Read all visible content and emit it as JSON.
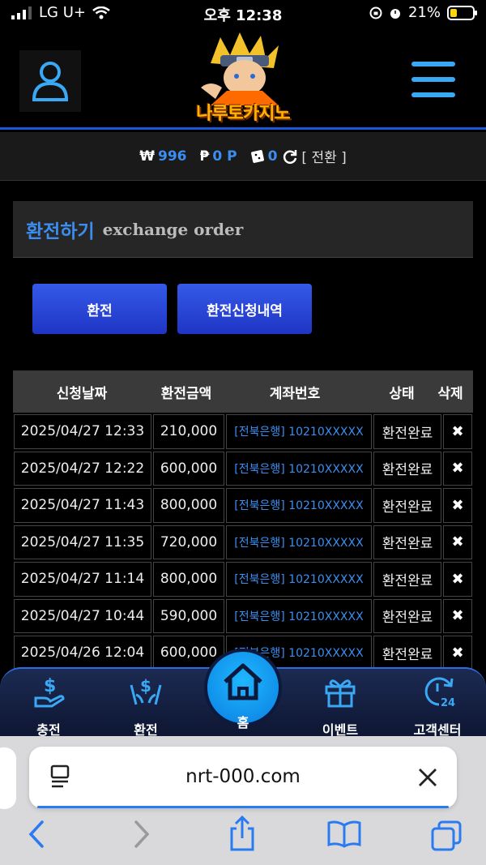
{
  "status_bar": {
    "carrier": "LG U+",
    "time": "오후 12:38",
    "battery": "21%"
  },
  "header": {
    "logo_text": "나루토카지노"
  },
  "balance": {
    "won_symbol": "₩",
    "won_value": "996",
    "point_symbol": "₱",
    "point_value": "0 P",
    "chip_value": "0",
    "convert_label": "[ 전환 ]"
  },
  "section": {
    "title_ko": "환전하기",
    "title_en": "exchange order"
  },
  "buttons": {
    "exchange": "환전",
    "history": "환전신청내역"
  },
  "table": {
    "headers": [
      "신청날짜",
      "환전금액",
      "계좌번호",
      "상태",
      "삭제"
    ],
    "rows": [
      {
        "date": "2025/04/27 12:33",
        "amount": "210,000",
        "account": "[전북은행] 10210XXXXX",
        "status": "환전완료"
      },
      {
        "date": "2025/04/27 12:22",
        "amount": "600,000",
        "account": "[전북은행] 10210XXXXX",
        "status": "환전완료"
      },
      {
        "date": "2025/04/27 11:43",
        "amount": "800,000",
        "account": "[전북은행] 10210XXXXX",
        "status": "환전완료"
      },
      {
        "date": "2025/04/27 11:35",
        "amount": "720,000",
        "account": "[전북은행] 10210XXXXX",
        "status": "환전완료"
      },
      {
        "date": "2025/04/27 11:14",
        "amount": "800,000",
        "account": "[전북은행] 10210XXXXX",
        "status": "환전완료"
      },
      {
        "date": "2025/04/27 10:44",
        "amount": "590,000",
        "account": "[전북은행] 10210XXXXX",
        "status": "환전완료"
      },
      {
        "date": "2025/04/26 12:04",
        "amount": "600,000",
        "account": "[전북은행] 10210XXXXX",
        "status": "환전완료"
      }
    ]
  },
  "bottom_nav": {
    "deposit": "충전",
    "withdraw": "환전",
    "home": "홈",
    "event": "이벤트",
    "support": "고객센터"
  },
  "browser": {
    "url": "nrt-000.com"
  },
  "colors": {
    "accent": "#3b8ef0",
    "button": "#2a46d8",
    "nav_bg": "#1c2a52"
  }
}
